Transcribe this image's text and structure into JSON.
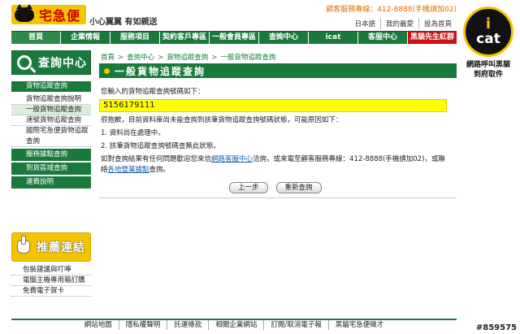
{
  "header": {
    "logo_text": "宅急便",
    "slogan": "小心翼翼 有如親送",
    "hotline": "顧客服務專線：412-8888(手機請加02)",
    "top_links": [
      "日本語",
      "我的最愛",
      "設為首頁"
    ]
  },
  "nav": {
    "items": [
      "首頁",
      "企業情報",
      "服務項目",
      "契約客戶專區",
      "一般會員專區",
      "查詢中心",
      "icat",
      "客服中心",
      "黑貓先生紅群"
    ]
  },
  "ad": {
    "i": "i",
    "cat": "cat",
    "caption_1": "網路呼叫黑貓",
    "caption_2": "到府取件"
  },
  "sidebar": {
    "title": "查詢中心",
    "section": "貨物追蹤查詢",
    "subitems": [
      "貨物追蹤查詢說明",
      "一般貨物追蹤查詢",
      "速號貨物追蹤查詢",
      "國際宅急便貨物追蹤查詢"
    ],
    "items": [
      "服務據點查詢",
      "到貨區域查詢",
      "運費說明"
    ]
  },
  "recommend": {
    "title": "推薦連結",
    "items": [
      "包裝建議與叮嚀",
      "電腦主機專用箱訂購",
      "免費電子賀卡"
    ]
  },
  "main": {
    "breadcrumb": [
      "首頁",
      "查詢中心",
      "貨物追蹤查詢",
      "一般貨物追蹤查詢"
    ],
    "breadcrumb_sep": ">",
    "title": "一般貨物追蹤查詢",
    "intro": "您輸入的貨物追蹤查詢號碼如下：",
    "tracking_number": "5156179111",
    "apology": "很抱歉，目前資料庫尚未能查詢到該筆貨物追蹤查詢號碼狀態，可能原因如下：",
    "reason_1": "1. 資料尚在處理中。",
    "reason_2": "2. 該筆貨物追蹤查詢號碼查無此狀態。",
    "contact_a": "如對查詢結果有任何問題歡迎您來信",
    "contact_link1": "網路客服中心",
    "contact_b": "洽詢，或來電至顧客服務專線：412-8888(手機請加02)，或聯絡",
    "contact_link2": "各地營業據點",
    "contact_c": "查詢。",
    "btn_prev": "上一步",
    "btn_requery": "重新查詢"
  },
  "footer": {
    "links": [
      "網站地圖",
      "隱私權聲明",
      "託運條款",
      "相關企業網站",
      "訂閱/取消電子報",
      "黑貓宅急便徵才"
    ]
  },
  "watermark": "#859575"
}
